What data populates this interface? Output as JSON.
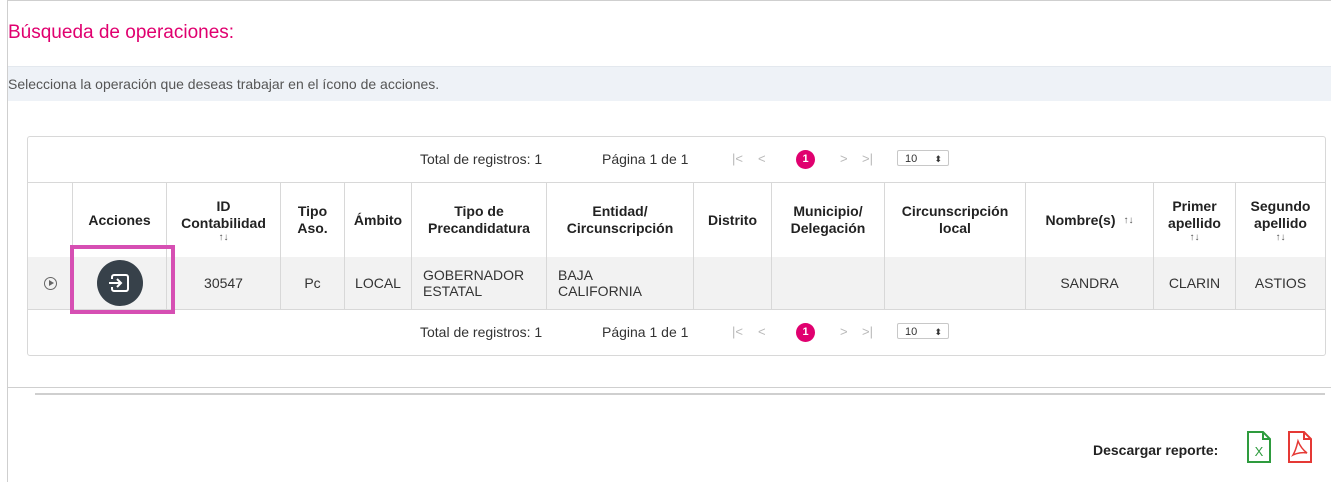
{
  "page": {
    "title": "Búsqueda de operaciones:",
    "instructions": "Selecciona la operación que deseas trabajar en el ícono de acciones."
  },
  "pager": {
    "total_label": "Total de registros: 1",
    "page_label": "Página 1 de 1",
    "first": "|<",
    "prev": "<",
    "current": "1",
    "next": ">",
    "last": ">|",
    "page_size": "10",
    "page_size_caret": "⬍"
  },
  "table": {
    "columns": [
      {
        "line1": "",
        "line2": "",
        "sort": ""
      },
      {
        "line1": "Acciones",
        "line2": "",
        "sort": ""
      },
      {
        "line1": "ID",
        "line2": "Contabilidad",
        "sort": "↑↓"
      },
      {
        "line1": "Tipo",
        "line2": "Aso.",
        "sort": ""
      },
      {
        "line1": "Ámbito",
        "line2": "",
        "sort": ""
      },
      {
        "line1": "Tipo de",
        "line2": "Precandidatura",
        "sort": ""
      },
      {
        "line1": "Entidad/",
        "line2": "Circunscripción",
        "sort": ""
      },
      {
        "line1": "Distrito",
        "line2": "",
        "sort": ""
      },
      {
        "line1": "Municipio/",
        "line2": "Delegación",
        "sort": ""
      },
      {
        "line1": "Circunscripción",
        "line2": "local",
        "sort": ""
      },
      {
        "line1": "Nombre(s)",
        "line2": "",
        "sort": "↑↓"
      },
      {
        "line1": "Primer",
        "line2": "apellido",
        "sort": "↑↓"
      },
      {
        "line1": "Segundo",
        "line2": "apellido",
        "sort": "↑↓"
      }
    ],
    "row": {
      "id": "30547",
      "tipo_aso": "Pc",
      "ambito": "LOCAL",
      "tipo_precandidatura": "GOBERNADOR ESTATAL",
      "entidad": "BAJA CALIFORNIA",
      "distrito": "",
      "municipio": "",
      "circ_local": "",
      "nombre": "SANDRA",
      "primer_apellido": "CLARIN",
      "segundo_apellido": "ASTIOS"
    }
  },
  "footer": {
    "download_label": "Descargar reporte:",
    "xls_icon": "excel-icon",
    "pdf_icon": "pdf-icon",
    "xls_color": "#2e9b3e",
    "pdf_color": "#e53935"
  },
  "colors": {
    "accent": "#e0006f",
    "action_button": "#37414a",
    "highlight": "#d64fb3"
  }
}
